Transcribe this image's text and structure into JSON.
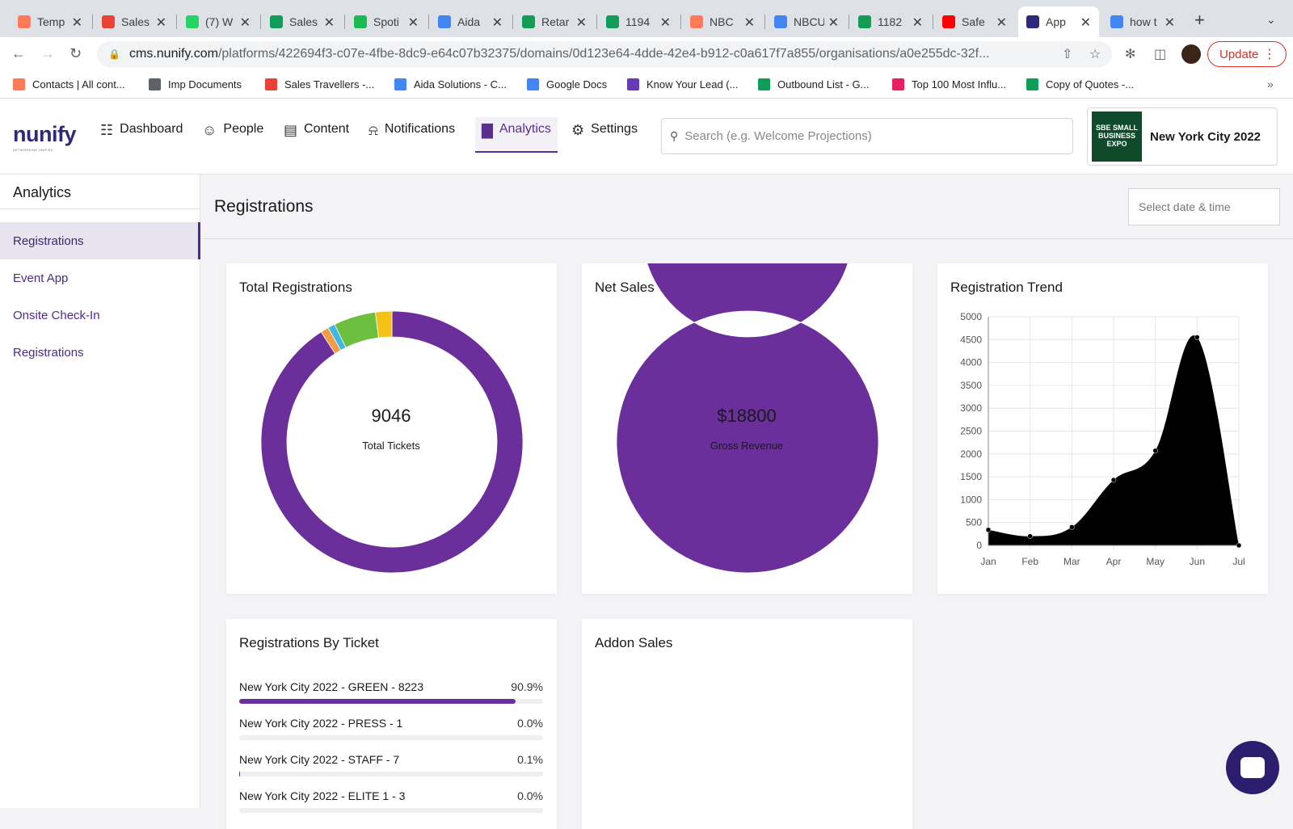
{
  "browser": {
    "tabs": [
      {
        "title": "Temp",
        "color": "#ff7a59",
        "icon": "hubspot-icon"
      },
      {
        "title": "Sales",
        "color": "#ea4335",
        "icon": "gmail-icon"
      },
      {
        "title": "(7) W",
        "color": "#25d366",
        "icon": "whatsapp-icon"
      },
      {
        "title": "Sales",
        "color": "#0f9d58",
        "icon": "sheets-icon"
      },
      {
        "title": "Spoti",
        "color": "#1db954",
        "icon": "spotify-icon"
      },
      {
        "title": "Aida",
        "color": "#4285f4",
        "icon": "calendar-icon"
      },
      {
        "title": "Retar",
        "color": "#0f9d58",
        "icon": "sheets-icon"
      },
      {
        "title": "1194",
        "color": "#0f9d58",
        "icon": "sheets-icon"
      },
      {
        "title": "NBC",
        "color": "#ff7a59",
        "icon": "hubspot-icon"
      },
      {
        "title": "NBCU",
        "color": "#4285f4",
        "icon": "docs-icon"
      },
      {
        "title": "1182",
        "color": "#0f9d58",
        "icon": "sheets-icon"
      },
      {
        "title": "Safe",
        "color": "#ff0000",
        "icon": "youtube-icon"
      },
      {
        "title": "App",
        "color": "#2e2a7a",
        "icon": "nunify-icon",
        "active": true
      },
      {
        "title": "how t",
        "color": "#4285f4",
        "icon": "google-icon"
      }
    ],
    "new_tab": "+",
    "url_host": "cms.nunify.com",
    "url_path": "/platforms/422694f3-c07e-4fbe-8dc9-e64c07b32375/domains/0d123e64-4dde-42e4-b912-c0a617f7a855/organisations/a0e255dc-32f...",
    "update_label": "Update",
    "bookmarks": [
      {
        "label": "Contacts | All cont...",
        "color": "#ff7a59",
        "icon": "hubspot-icon"
      },
      {
        "label": "Imp Documents",
        "color": "#5f6368",
        "icon": "folder-icon"
      },
      {
        "label": "Sales Travellers -...",
        "color": "#ea4335",
        "icon": "gmail-icon"
      },
      {
        "label": "Aida Solutions - C...",
        "color": "#4285f4",
        "icon": "calendar-icon"
      },
      {
        "label": "Google Docs",
        "color": "#4285f4",
        "icon": "docs-icon"
      },
      {
        "label": "Know Your Lead (...",
        "color": "#673ab7",
        "icon": "forms-icon"
      },
      {
        "label": "Outbound List - G...",
        "color": "#0f9d58",
        "icon": "sheets-icon"
      },
      {
        "label": "Top 100 Most Influ...",
        "color": "#e91e63",
        "icon": "pinwheel-icon"
      },
      {
        "label": "Copy of Quotes -...",
        "color": "#0f9d58",
        "icon": "sheets-icon"
      }
    ]
  },
  "app": {
    "logo": "nunify",
    "logo_tagline": "NETWORKING UNIFIED",
    "nav": [
      {
        "label": "Dashboard",
        "icon": "grid-icon"
      },
      {
        "label": "People",
        "icon": "people-icon"
      },
      {
        "label": "Content",
        "icon": "document-icon"
      },
      {
        "label": "Notifications",
        "icon": "bell-icon"
      },
      {
        "label": "Analytics",
        "icon": "bar-chart-icon",
        "active": true
      },
      {
        "label": "Settings",
        "icon": "gear-icon"
      }
    ],
    "search_placeholder": "Search (e.g. Welcome Projections)",
    "event_logo_text": "SBE SMALL BUSINESS EXPO",
    "event_name": "New York City 2022"
  },
  "sidebar": {
    "title": "Analytics",
    "items": [
      {
        "label": "Registrations",
        "active": true
      },
      {
        "label": "Event App"
      },
      {
        "label": "Onsite Check-In"
      },
      {
        "label": "Registrations"
      }
    ]
  },
  "main": {
    "title": "Registrations",
    "date_placeholder": "Select date & time",
    "cards": {
      "total_registrations": {
        "title": "Total Registrations",
        "value": "9046",
        "caption": "Total Tickets"
      },
      "net_sales": {
        "title": "Net Sales",
        "value": "$18800",
        "caption": "Gross Revenue"
      },
      "registration_trend": {
        "title": "Registration Trend"
      },
      "by_ticket": {
        "title": "Registrations By Ticket",
        "rows": [
          {
            "label": "New York City 2022 - GREEN - 8223",
            "pct": "90.9%",
            "value": 0.909
          },
          {
            "label": "New York City 2022 - PRESS - 1",
            "pct": "0.0%",
            "value": 0.0
          },
          {
            "label": "New York City 2022 - STAFF - 7",
            "pct": "0.1%",
            "value": 0.001
          },
          {
            "label": "New York City 2022 - ELITE 1 - 3",
            "pct": "0.0%",
            "value": 0.0
          }
        ]
      },
      "addon_sales": {
        "title": "Addon Sales"
      }
    }
  },
  "chart_data": [
    {
      "type": "pie",
      "title": "Total Registrations",
      "categories": [
        "GREEN",
        "orange segment",
        "blue segment",
        "green segment",
        "yellow segment"
      ],
      "values": [
        8223,
        90,
        80,
        470,
        183
      ],
      "colors": [
        "#6a2f9a",
        "#f39c40",
        "#3fb7e8",
        "#6cbf3f",
        "#f2c218"
      ]
    },
    {
      "type": "pie",
      "title": "Net Sales",
      "categories": [
        "Gross Revenue"
      ],
      "values": [
        18800
      ],
      "colors": [
        "#6a2f9a"
      ]
    },
    {
      "type": "area",
      "title": "Registration Trend",
      "categories": [
        "Jan",
        "Feb",
        "Mar",
        "Apr",
        "May",
        "Jun",
        "Jul"
      ],
      "values": [
        340,
        200,
        400,
        1430,
        2070,
        4550,
        0
      ],
      "ylim": [
        0,
        5000
      ],
      "yticks": [
        0,
        500,
        1000,
        1500,
        2000,
        2500,
        3000,
        3500,
        4000,
        4500,
        5000
      ],
      "grid": true,
      "color": "#000000"
    }
  ]
}
